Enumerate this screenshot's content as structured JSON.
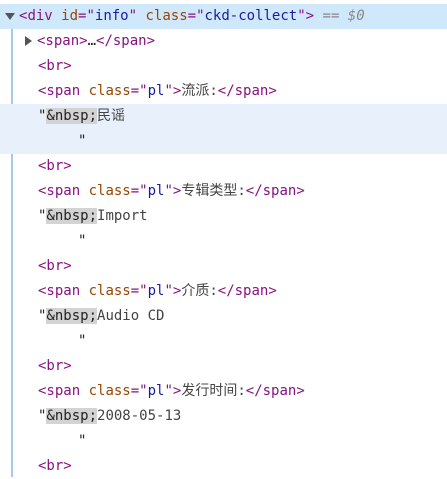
{
  "root": {
    "tag": "div",
    "attrs": [
      {
        "name": "id",
        "value": "info"
      },
      {
        "name": "class",
        "value": "ckd-collect"
      }
    ],
    "marker": "== $0"
  },
  "collapsed_span": {
    "open": "<span>",
    "ellipsis": "…",
    "close": "</span>"
  },
  "br": "<br>",
  "span_open": "<span",
  "span_class_attr": "class",
  "span_class_value": "pl",
  "span_close": "</span>",
  "nbsp": "&nbsp;",
  "quote": "\"",
  "fields": [
    {
      "label": "流派:",
      "value": "民谣"
    },
    {
      "label": "专辑类型:",
      "value": "Import"
    },
    {
      "label": "介质:",
      "value": "Audio CD"
    },
    {
      "label": "发行时间:",
      "value": "2008-05-13"
    }
  ],
  "colors": {
    "selected_bg": "#cfe8fc",
    "hover_bg": "#e8f0fb",
    "tag": "#881280",
    "attr_name": "#994500",
    "attr_value": "#1a1aa6"
  }
}
